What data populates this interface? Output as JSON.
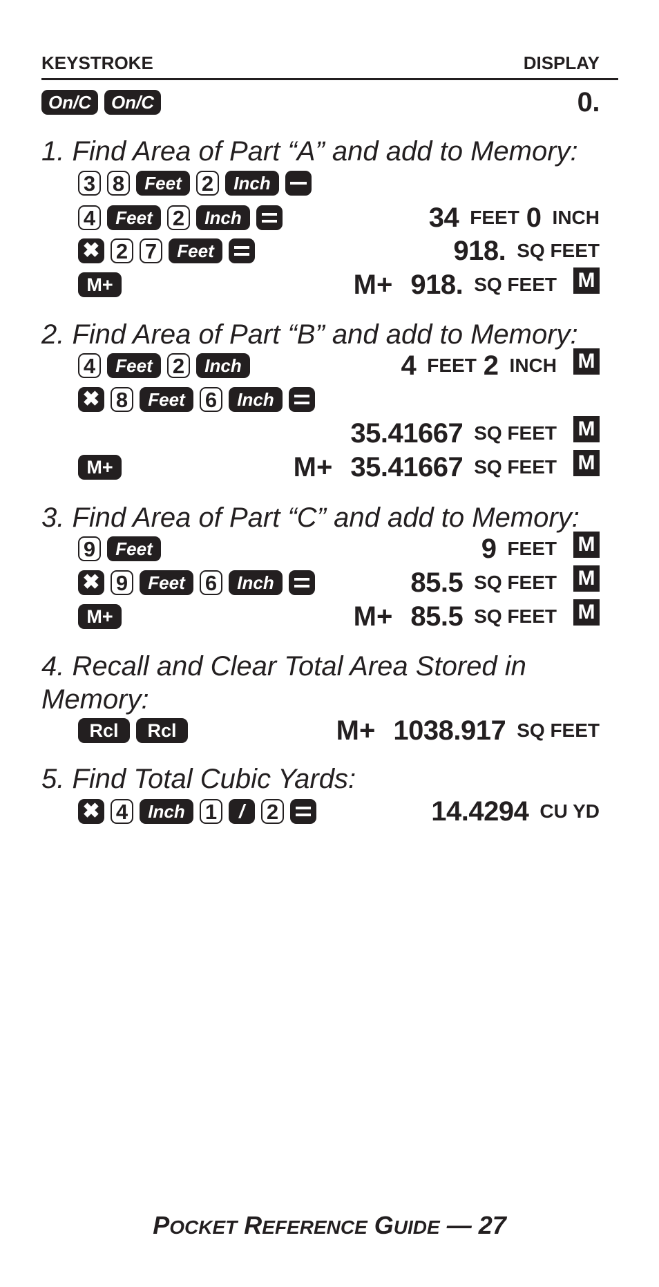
{
  "header": {
    "left": "KEYSTROKE",
    "right": "DISPLAY"
  },
  "intro": {
    "keys": [
      {
        "type": "dark",
        "label": "On/C",
        "name": "on-clear-key"
      },
      {
        "type": "dark",
        "label": "On/C",
        "name": "on-clear-key"
      }
    ],
    "display": {
      "value": "0."
    }
  },
  "steps": [
    {
      "heading": "1. Find Area of Part “A” and add to Memory:",
      "rows": [
        {
          "keys": [
            "3",
            "8",
            "Feet",
            "2",
            "Inch",
            "−"
          ],
          "display": null
        },
        {
          "keys": [
            "4",
            "Feet",
            "2",
            "Inch",
            "="
          ],
          "display": {
            "parts": [
              "34",
              "FEET",
              "0",
              "INCH"
            ],
            "memory": false
          }
        },
        {
          "keys": [
            "×",
            "2",
            "7",
            "Feet",
            "="
          ],
          "display": {
            "value": "918.",
            "unit": "SQ FEET",
            "memory": false
          }
        },
        {
          "keys": [
            "M+"
          ],
          "display": {
            "prefix": "M+",
            "value": "918.",
            "unit": "SQ FEET",
            "memory": true
          }
        }
      ]
    },
    {
      "heading": "2. Find Area of Part “B” and add to Memory:",
      "rows": [
        {
          "keys": [
            "4",
            "Feet",
            "2",
            "Inch"
          ],
          "display": {
            "parts": [
              "4",
              "FEET",
              "2",
              "INCH"
            ],
            "memory": true
          }
        },
        {
          "keys": [
            "×",
            "8",
            "Feet",
            "6",
            "Inch",
            "="
          ],
          "display": null
        },
        {
          "keys": [],
          "display": {
            "value": "35.41667",
            "unit": "SQ FEET",
            "memory": true
          }
        },
        {
          "keys": [
            "M+"
          ],
          "display": {
            "prefix": "M+",
            "value": "35.41667",
            "unit": "SQ FEET",
            "memory": true
          }
        }
      ]
    },
    {
      "heading": "3. Find Area of Part “C” and add to Memory:",
      "rows": [
        {
          "keys": [
            "9",
            "Feet"
          ],
          "display": {
            "value": "9",
            "unit": "FEET",
            "memory": true
          }
        },
        {
          "keys": [
            "×",
            "9",
            "Feet",
            "6",
            "Inch",
            "="
          ],
          "display": {
            "value": "85.5",
            "unit": "SQ FEET",
            "memory": true
          }
        },
        {
          "keys": [
            "M+"
          ],
          "display": {
            "prefix": "M+",
            "value": "85.5",
            "unit": "SQ FEET",
            "memory": true
          }
        }
      ]
    },
    {
      "heading": "4. Recall and Clear Total Area Stored in",
      "heading2": "Memory:",
      "rows": [
        {
          "keys": [
            "Rcl",
            "Rcl"
          ],
          "display": {
            "prefix": "M+",
            "value": "1038.917",
            "unit": "SQ FEET",
            "memory": false
          }
        }
      ]
    },
    {
      "heading": "5. Find Total Cubic Yards:",
      "rows": [
        {
          "keys": [
            "×",
            "4",
            "Inch",
            "1",
            "/",
            "2",
            "="
          ],
          "display": {
            "value": "14.4294",
            "unit": "CU YD",
            "memory": false
          }
        }
      ]
    }
  ],
  "memory_indicator": "M",
  "footer": {
    "parts": [
      {
        "big": "P",
        "small": "OCKET"
      },
      {
        "big": "R",
        "small": "EFERENCE"
      },
      {
        "big": "G",
        "small": "UIDE"
      }
    ],
    "suffix": "— 27"
  }
}
